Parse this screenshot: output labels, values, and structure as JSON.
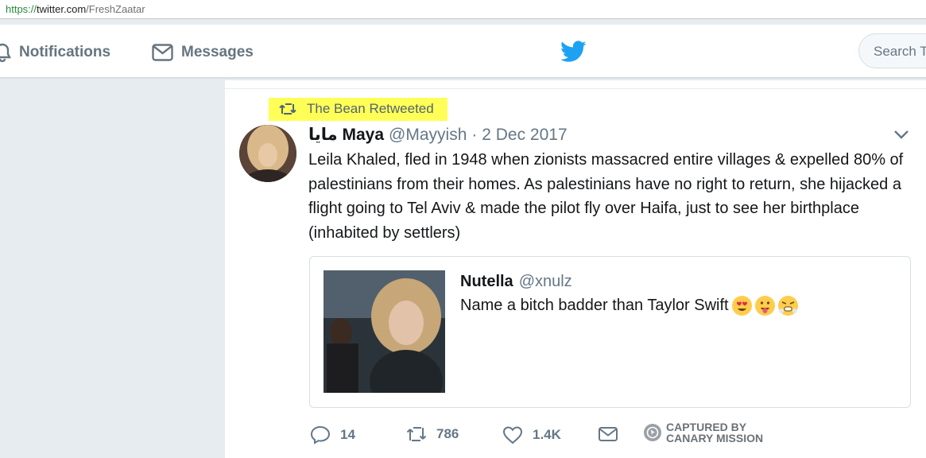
{
  "browser": {
    "url_scheme": "https://",
    "url_host": "twitter.com",
    "url_path": "/FreshZaatar"
  },
  "nav": {
    "notifications": "Notifications",
    "messages": "Messages",
    "search_placeholder": "Search T"
  },
  "retweet": {
    "label": "The Bean Retweeted"
  },
  "tweet": {
    "name": "مايا Maya",
    "handle": "@Mayyish",
    "date": "· 2 Dec 2017",
    "text": "Leila Khaled, fled in 1948 when zionists massacred entire villages & expelled 80% of palestinians from their homes. As palestinians have no right to return, she hijacked a flight going to Tel Aviv & made the pilot fly over Haifa, just to see her birthplace (inhabited by settlers)"
  },
  "quote": {
    "name": "Nutella",
    "handle": "@xnulz",
    "text": "Name a bitch badder than Taylor Swift",
    "emojis": [
      "heart-eyes",
      "tongue-out",
      "triumph"
    ]
  },
  "actions": {
    "replies": "14",
    "retweets": "786",
    "likes": "1.4K"
  },
  "watermark": {
    "line1": "CAPTURED BY",
    "line2": "CANARY MISSION"
  },
  "colors": {
    "twitter_blue": "#1da1f2",
    "highlight": "#ffff57",
    "gray_text": "#657786"
  }
}
